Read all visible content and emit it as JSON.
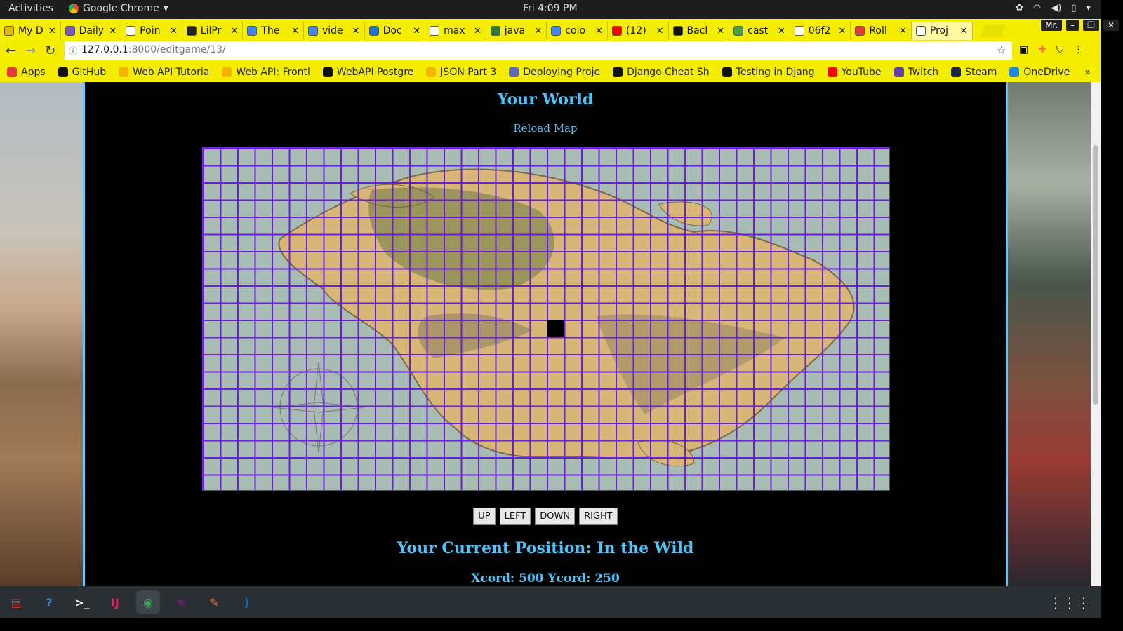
{
  "topbar": {
    "activities": "Activities",
    "app_name": "Google Chrome",
    "clock": "Fri  4:09 PM"
  },
  "tabs": [
    {
      "label": "My D",
      "color": "#e6b800"
    },
    {
      "label": "Daily",
      "color": "#7e57c2"
    },
    {
      "label": "Poin",
      "color": "#ffffff"
    },
    {
      "label": "LilPr",
      "color": "#222222"
    },
    {
      "label": "The",
      "color": "#4285f4"
    },
    {
      "label": "vide",
      "color": "#4285f4"
    },
    {
      "label": "Doc",
      "color": "#1976d2"
    },
    {
      "label": "max",
      "color": "#ffffff"
    },
    {
      "label": "java",
      "color": "#2e7d32"
    },
    {
      "label": "colo",
      "color": "#4285f4"
    },
    {
      "label": "(12)",
      "color": "#ff0000"
    },
    {
      "label": "Bacl",
      "color": "#111111"
    },
    {
      "label": "cast",
      "color": "#43a047"
    },
    {
      "label": "06f2",
      "color": "#ffffff"
    },
    {
      "label": "Roll",
      "color": "#e53935"
    },
    {
      "label": "Proj",
      "color": "#ffffff"
    }
  ],
  "window_badge": "Mr.",
  "address": {
    "host": "127.0.0.1",
    "rest": ":8000/editgame/13/"
  },
  "bookmarks": [
    {
      "label": "Apps",
      "color": "#e53935"
    },
    {
      "label": "GitHub",
      "color": "#111111"
    },
    {
      "label": "Web API Tutoria",
      "color": "#f4b400"
    },
    {
      "label": "Web API: Frontl",
      "color": "#f4b400"
    },
    {
      "label": "WebAPI Postgre",
      "color": "#111111"
    },
    {
      "label": "JSON Part 3",
      "color": "#f4b400"
    },
    {
      "label": "Deploying Proje",
      "color": "#5c6bc0"
    },
    {
      "label": "Django Cheat Sh",
      "color": "#111111"
    },
    {
      "label": "Testing in Djang",
      "color": "#111111"
    },
    {
      "label": "YouTube",
      "color": "#ff0000"
    },
    {
      "label": "Twitch",
      "color": "#6441a5"
    },
    {
      "label": "Steam",
      "color": "#1b2838"
    },
    {
      "label": "OneDrive",
      "color": "#1e88e5"
    }
  ],
  "page": {
    "title": "Your World",
    "reload_link": "Reload Map",
    "controls": [
      "UP",
      "LEFT",
      "DOWN",
      "RIGHT"
    ],
    "position_label": "Your Current Position: In the Wild",
    "coords_label": "Xcord: 500 Ycord: 250",
    "accent_color": "#4fc3f7",
    "grid_color": "#6a1fd8"
  },
  "dock": [
    {
      "name": "files-icon",
      "color": "#c0392b",
      "glyph": "▤"
    },
    {
      "name": "help-icon",
      "color": "#3b82c4",
      "glyph": "?"
    },
    {
      "name": "terminal-icon",
      "color": "#333333",
      "glyph": ">_"
    },
    {
      "name": "intellij-icon",
      "color": "#e91e63",
      "glyph": "IJ"
    },
    {
      "name": "chrome-icon",
      "color": "#34a853",
      "glyph": "◉"
    },
    {
      "name": "slack-icon",
      "color": "#611f69",
      "glyph": "✱"
    },
    {
      "name": "postman-icon",
      "color": "#ff6c37",
      "glyph": "✎"
    },
    {
      "name": "vscode-icon",
      "color": "#0078d4",
      "glyph": "⟩"
    }
  ]
}
